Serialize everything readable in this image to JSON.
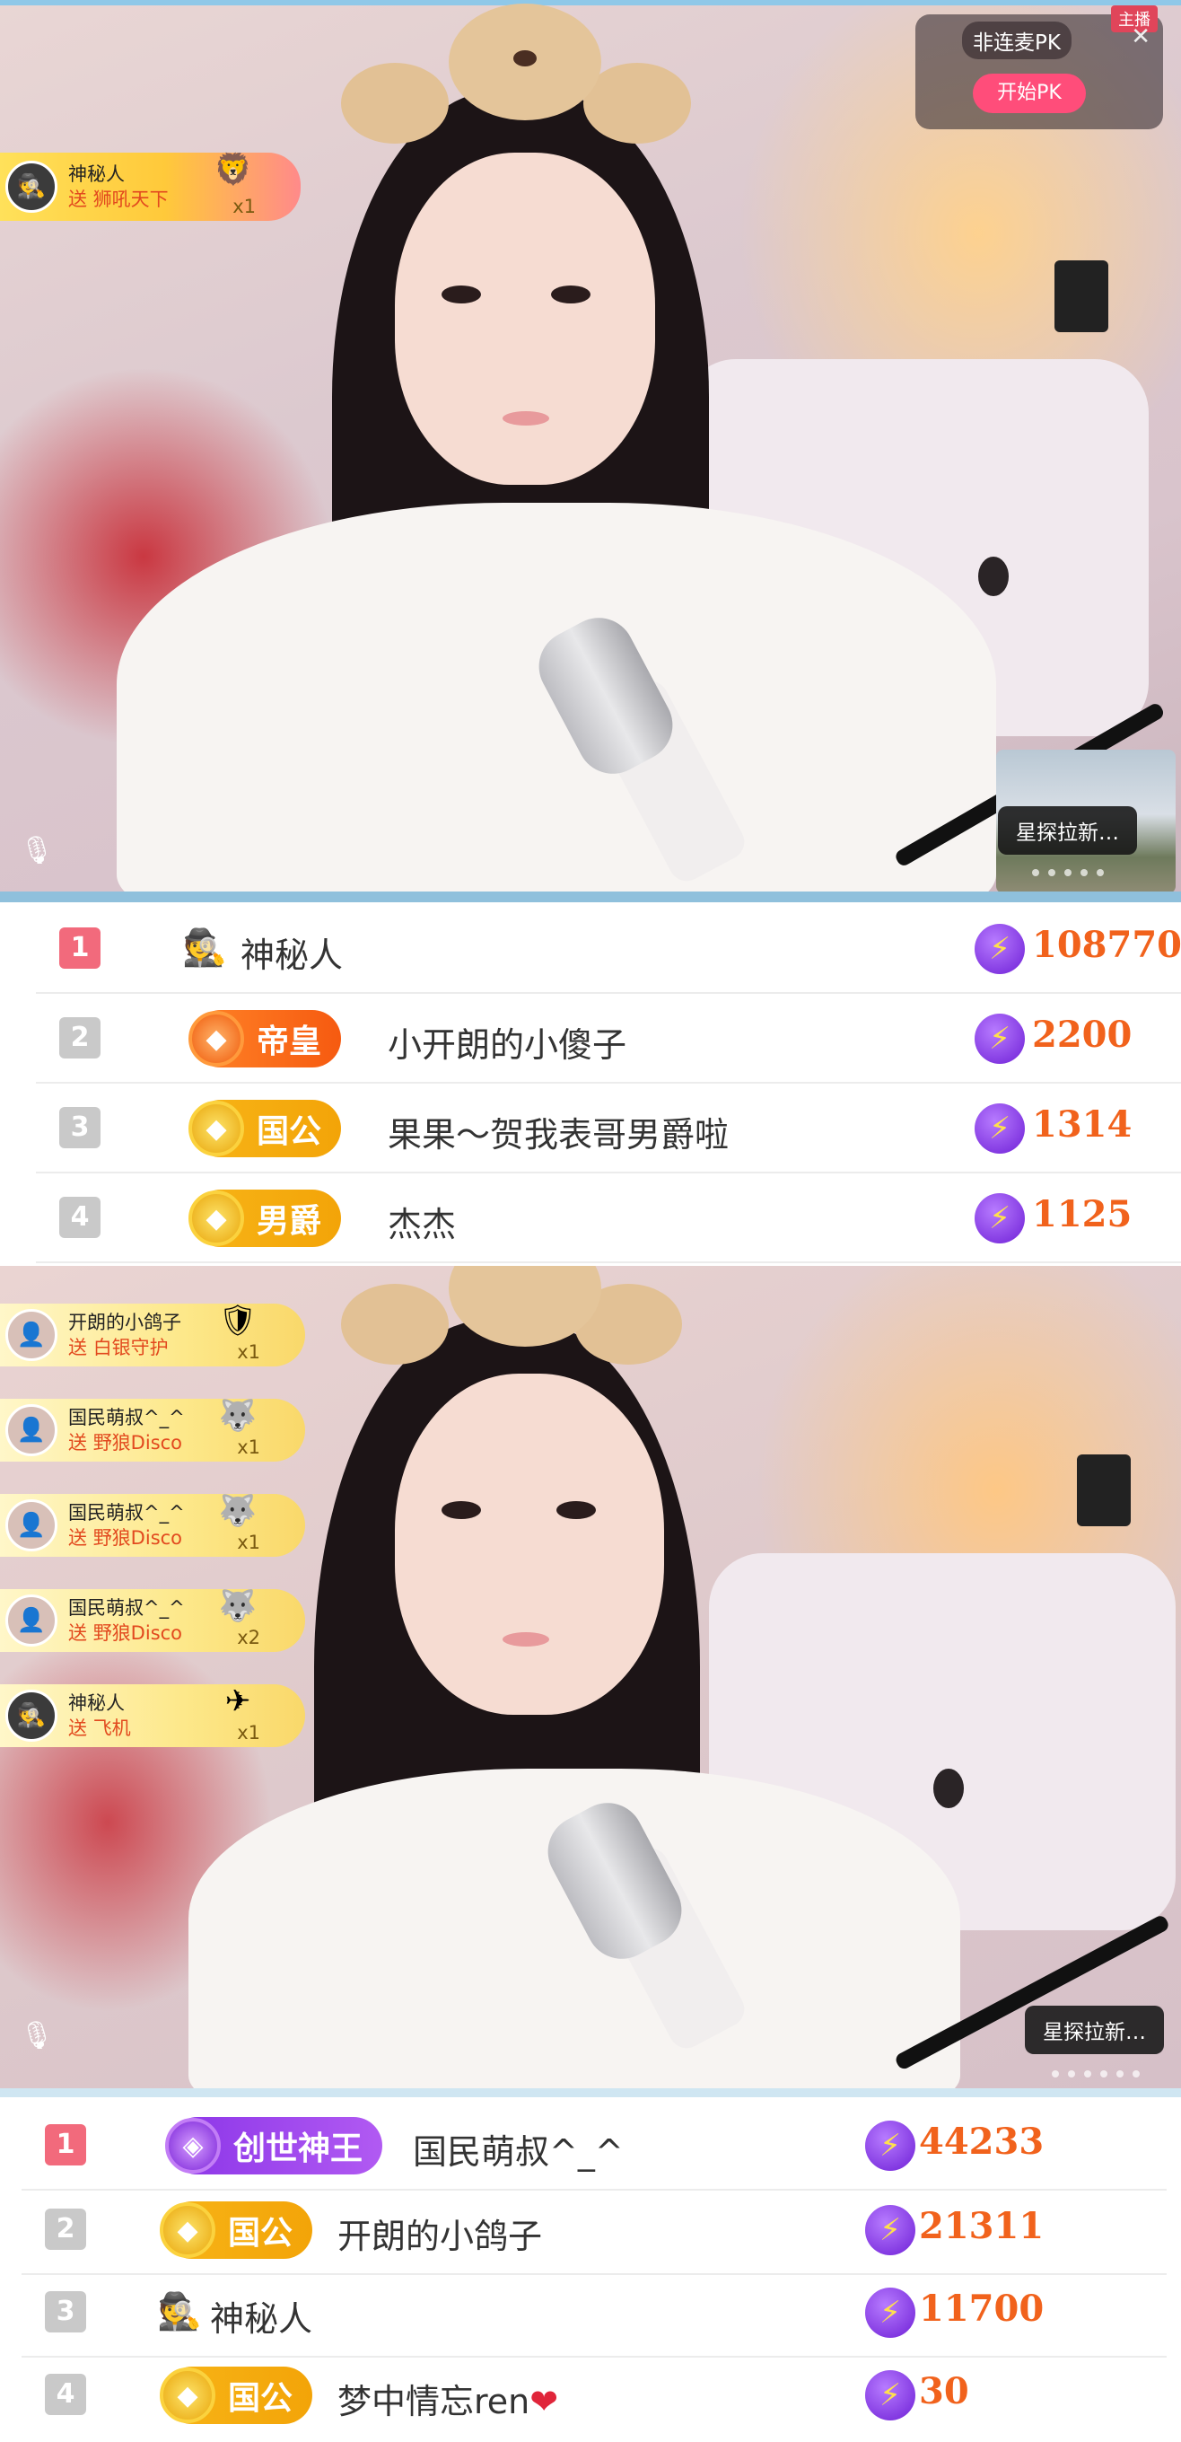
{
  "top_stream": {
    "gift": {
      "name": "神秘人",
      "verb": "送",
      "item": "狮吼天下",
      "count": "x1",
      "avatar_icon": "incognito-user-icon"
    },
    "pk": {
      "title": "非连麦PK",
      "start_label": "开始PK",
      "close_icon": "close-icon",
      "badge": "主播"
    },
    "mic_icon": "microphone-icon",
    "scout_label": "星探拉新…"
  },
  "rank_list_1": [
    {
      "rank": "1",
      "tier": "",
      "user": "神秘人",
      "score": "108770",
      "hat_icon": "incognito-hat-icon"
    },
    {
      "rank": "2",
      "tier": "帝皇",
      "user": "小开朗的小傻子",
      "score": "2200"
    },
    {
      "rank": "3",
      "tier": "国公",
      "user": "果果～贺我表哥男爵啦",
      "score": "1314"
    },
    {
      "rank": "4",
      "tier": "男爵",
      "user": "杰杰",
      "score": "1125"
    }
  ],
  "bottom_stream": {
    "gifts": [
      {
        "name": "开朗的小鸽子",
        "verb": "送",
        "item": "白银守护",
        "count": "x1"
      },
      {
        "name": "国民萌叔^_^",
        "verb": "送",
        "item": "野狼Disco",
        "count": "x1"
      },
      {
        "name": "国民萌叔^_^",
        "verb": "送",
        "item": "野狼Disco",
        "count": "x1"
      },
      {
        "name": "国民萌叔^_^",
        "verb": "送",
        "item": "野狼Disco",
        "count": "x2"
      },
      {
        "name": "神秘人",
        "verb": "送",
        "item": "飞机",
        "count": "x1"
      }
    ],
    "scout_label": "星探拉新…"
  },
  "rank_list_2": [
    {
      "rank": "1",
      "tier": "创世神王",
      "user": "国民萌叔^_^",
      "score": "44233"
    },
    {
      "rank": "2",
      "tier": "国公",
      "user": "开朗的小鸽子",
      "score": "21311"
    },
    {
      "rank": "3",
      "tier": "",
      "user": "神秘人",
      "score": "11700",
      "hat_icon": "incognito-hat-icon"
    },
    {
      "rank": "4",
      "tier": "国公",
      "user": "梦中情忘ren",
      "score": "30",
      "suffix_icon": "heart-icon"
    }
  ],
  "colors": {
    "accent_pink": "#ff4d7a",
    "score_orange": "#f1621c",
    "rank_first": "#f26a7c",
    "bolt_purple": "#6e1fd6"
  }
}
